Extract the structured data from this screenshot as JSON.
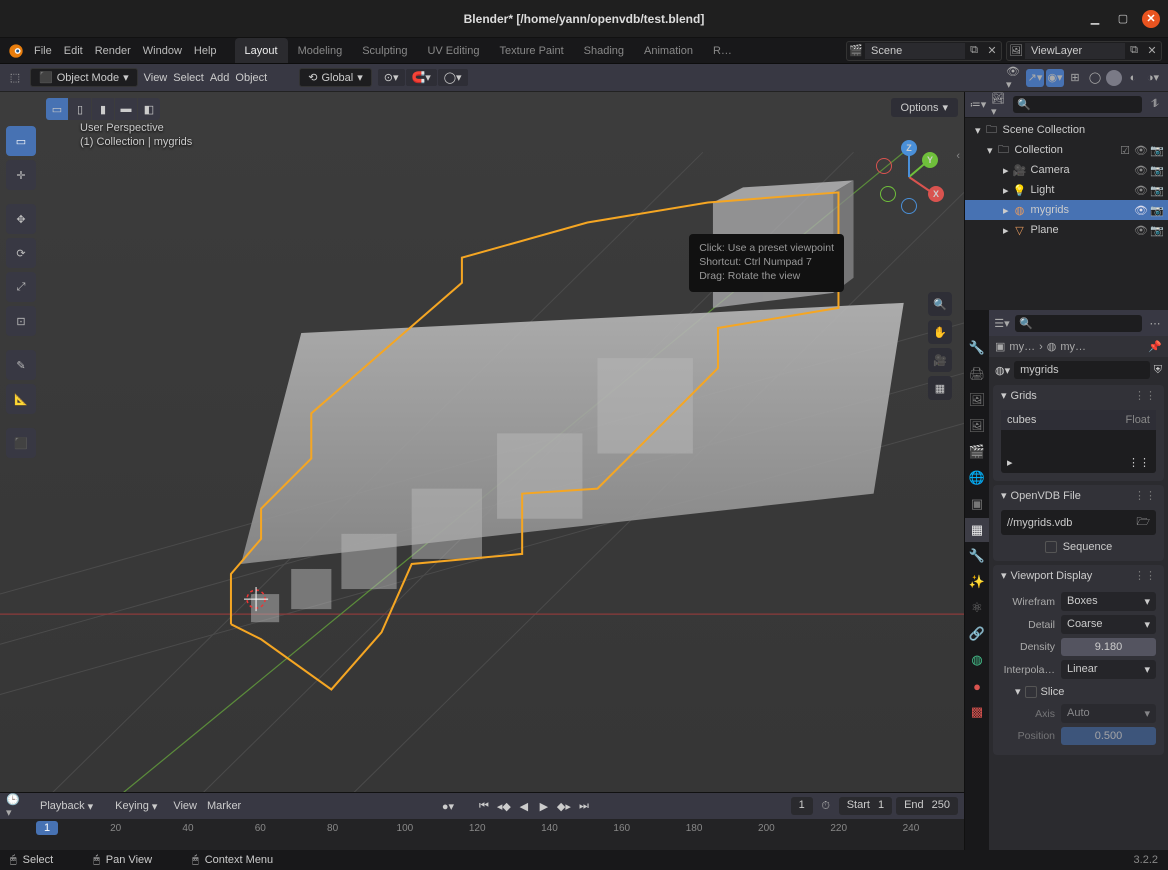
{
  "window": {
    "title": "Blender* [/home/yann/openvdb/test.blend]"
  },
  "menus": [
    "File",
    "Edit",
    "Render",
    "Window",
    "Help"
  ],
  "workspace_tabs": {
    "items": [
      "Layout",
      "Modeling",
      "Sculpting",
      "UV Editing",
      "Texture Paint",
      "Shading",
      "Animation",
      "R…"
    ],
    "active": "Layout"
  },
  "scene": {
    "label": "Scene"
  },
  "view_layer": {
    "label": "ViewLayer"
  },
  "header3d": {
    "editor_icon": "editor-3dview-icon",
    "mode": "Object Mode",
    "menus": [
      "View",
      "Select",
      "Add",
      "Object"
    ],
    "orientation": "Global",
    "options_label": "Options"
  },
  "viewport_info": {
    "line1": "User Perspective",
    "line2": "(1) Collection | mygrids"
  },
  "tooltip": {
    "line1": "Click: Use a preset viewpoint",
    "line2": "Shortcut: Ctrl Numpad 7",
    "line3": "Drag: Rotate the view"
  },
  "outliner": {
    "root": "Scene Collection",
    "collection": "Collection",
    "items": [
      {
        "name": "Camera",
        "icon": "camera",
        "selected": false
      },
      {
        "name": "Light",
        "icon": "light",
        "selected": false
      },
      {
        "name": "mygrids",
        "icon": "volume",
        "selected": true
      },
      {
        "name": "Plane",
        "icon": "mesh",
        "selected": false
      }
    ]
  },
  "properties": {
    "breadcrumb": {
      "a": "my…",
      "b": "my…"
    },
    "object_name": "mygrids",
    "grids": {
      "header": "Grids",
      "item_name": "cubes",
      "item_type": "Float"
    },
    "openvdb": {
      "header": "OpenVDB File",
      "path": "//mygrids.vdb",
      "sequence_label": "Sequence"
    },
    "viewport_display": {
      "header": "Viewport Display",
      "wireframe": {
        "label": "Wirefram",
        "value": "Boxes"
      },
      "detail": {
        "label": "Detail",
        "value": "Coarse"
      },
      "density": {
        "label": "Density",
        "value": "9.180"
      },
      "interpolation": {
        "label": "Interpola…",
        "value": "Linear"
      },
      "slice": {
        "label": "Slice",
        "axis": {
          "label": "Axis",
          "value": "Auto"
        },
        "position": {
          "label": "Position",
          "value": "0.500"
        }
      }
    }
  },
  "timeline": {
    "menus": {
      "playback": "Playback",
      "keying": "Keying",
      "view": "View",
      "marker": "Marker"
    },
    "current": "1",
    "start_label": "Start",
    "start": "1",
    "end_label": "End",
    "end": "250",
    "ticks": [
      "20",
      "40",
      "60",
      "80",
      "100",
      "120",
      "140",
      "160",
      "180",
      "200",
      "220",
      "240"
    ],
    "cursor": "1"
  },
  "statusbar": {
    "select": "Select",
    "pan": "Pan View",
    "context": "Context Menu",
    "version": "3.2.2"
  }
}
